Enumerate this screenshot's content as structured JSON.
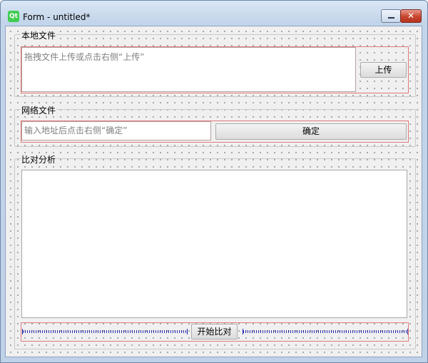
{
  "window": {
    "title": "Form - untitled*",
    "logo_text": "Qt",
    "close_glyph": "✕"
  },
  "local_file": {
    "group_title": "本地文件",
    "drop_hint": "拖拽文件上传或点击右侧“上传”",
    "upload_label": "上传"
  },
  "network_file": {
    "group_title": "网络文件",
    "placeholder": "输入地址后点击右侧“确定”",
    "confirm_label": "确定"
  },
  "compare": {
    "group_title": "比对分析",
    "start_label": "开始比对"
  },
  "colors": {
    "accent_layout": "#e27a7a",
    "spacer": "#2a2fb0",
    "qt_green": "#41cd52"
  }
}
